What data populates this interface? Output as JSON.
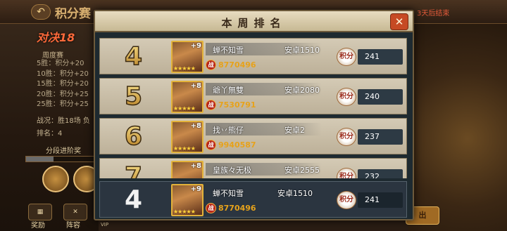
{
  "background": {
    "title": "积分赛",
    "top_right_text": "3天后结束",
    "season_badge": "对决18",
    "season_sub": "周度赛",
    "rules": [
      "5胜：积分+20",
      "10胜：积分+20",
      "15胜：积分+20",
      "20胜：积分+25",
      "25胜：积分+25"
    ],
    "record": "战况：胜18场 负",
    "rank_line": "排名：4",
    "tier_label": "分段进阶奖",
    "tier_progress": 0.4,
    "bottom_buttons": [
      "奖励",
      "阵容",
      "VIP"
    ],
    "right_button": "出"
  },
  "modal": {
    "title": "本周排名",
    "close_label": "✕",
    "score_icon_text": "积分",
    "rows": [
      {
        "rank": "4",
        "plus": "+9",
        "stars": "★★★★★",
        "name": "蝉不知雪",
        "server": "安卓1510",
        "power": "8770496",
        "score": "241"
      },
      {
        "rank": "5",
        "plus": "+8",
        "stars": "★★★★★",
        "name": "爺丫無雙",
        "server": "安卓2080",
        "power": "7530791",
        "score": "240"
      },
      {
        "rank": "6",
        "plus": "+8",
        "stars": "★★★★★",
        "name": "找丷熊仔",
        "server": "安卓2",
        "power": "9940587",
        "score": "237"
      },
      {
        "rank": "7",
        "plus": "+8",
        "stars": "★★★★★",
        "name": "皇族々无极",
        "server": "安卓2555",
        "power": "",
        "score": "232"
      }
    ],
    "my_row": {
      "rank": "4",
      "plus": "+9",
      "stars": "★★★★★",
      "name": "蝉不知雪",
      "server": "安卓1510",
      "power": "8770496",
      "score": "241"
    },
    "war_badge": "战"
  }
}
